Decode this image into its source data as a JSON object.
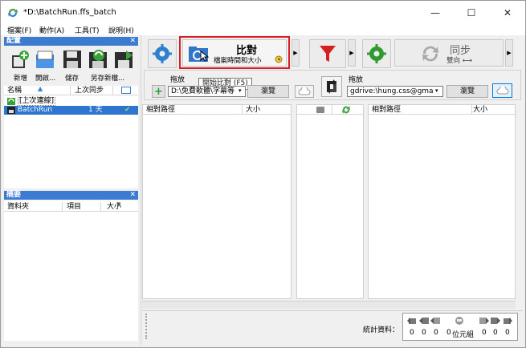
{
  "window": {
    "title": "*D:\\BatchRun.ffs_batch",
    "minimize": "—",
    "maximize": "☐",
    "close": "✕"
  },
  "menu": [
    "檔案(F)",
    "動作(A)",
    "工具(T)",
    "說明(H)"
  ],
  "config_panel": {
    "title": "配置",
    "close": "✕",
    "tools": [
      {
        "label": "新增",
        "icon": "new-config-icon"
      },
      {
        "label": "開啟...",
        "icon": "open-icon"
      },
      {
        "label": "儲存",
        "icon": "save-icon"
      },
      {
        "label": "另存新檔...",
        "icon": "save-as-icon"
      }
    ],
    "columns": {
      "name": "名稱",
      "last_sync": "上次同步"
    },
    "rows": [
      {
        "name": "[上次連線]",
        "last_sync": ""
      },
      {
        "name": "BatchRun",
        "last_sync": "1 天",
        "status": "✔"
      }
    ]
  },
  "summary_panel": {
    "title": "摘要",
    "close": "✕",
    "columns": [
      "資料夾",
      "項目",
      "大小"
    ]
  },
  "toolbar": {
    "compare_title": "比對",
    "compare_subtitle": "檔案時間和大小",
    "compare_tooltip": "開始比對 (F5)",
    "sync_title": "同步",
    "sync_subtitle": "雙向 ⟷"
  },
  "left_folder": {
    "label": "拖放",
    "path": "D:\\免費軟體\\字幕等",
    "browse": "瀏覽"
  },
  "right_folder": {
    "label": "拖放",
    "path": "gdrive:\\hung.css@gma",
    "browse": "瀏覽"
  },
  "grid": {
    "left_cols": [
      "相對路徑",
      "大小"
    ],
    "right_cols": [
      "相對路徑",
      "大小"
    ]
  },
  "status": {
    "label": "統計資料：",
    "counts": [
      "0",
      "0",
      "0",
      "0",
      "位元組",
      "0",
      "0",
      "0"
    ]
  }
}
